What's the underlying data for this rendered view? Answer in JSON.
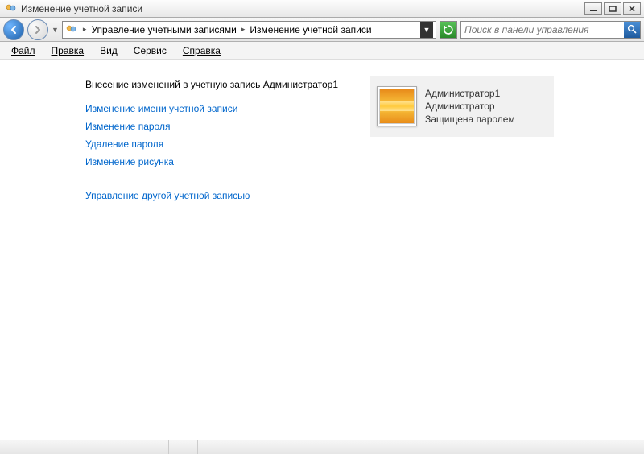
{
  "window": {
    "title": "Изменение учетной записи"
  },
  "navbar": {
    "breadcrumb": {
      "level1": "Управление учетными записями",
      "level2": "Изменение учетной записи"
    },
    "search_placeholder": "Поиск в панели управления"
  },
  "menubar": {
    "file": "Файл",
    "edit": "Правка",
    "view": "Вид",
    "tools": "Сервис",
    "help": "Справка"
  },
  "content": {
    "heading": "Внесение изменений в учетную запись Администратор1",
    "links": {
      "change_name": "Изменение имени учетной записи",
      "change_password": "Изменение пароля",
      "remove_password": "Удаление пароля",
      "change_picture": "Изменение рисунка",
      "manage_other": "Управление другой учетной записью"
    },
    "account": {
      "name": "Администратор1",
      "role": "Администратор",
      "status": "Защищена паролем"
    }
  }
}
